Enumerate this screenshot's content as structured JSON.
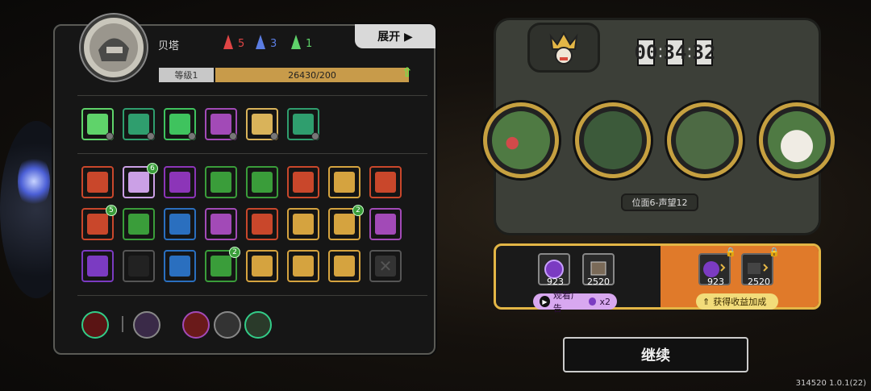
{
  "hero": {
    "name": "贝塔",
    "level_label": "等级1",
    "xp_text": "26430/200",
    "expand_label": "展开 ▶"
  },
  "runes": [
    {
      "color": "#e04545",
      "count": "5"
    },
    {
      "color": "#5b7de2",
      "count": "3"
    },
    {
      "color": "#5fd36a",
      "count": "1"
    }
  ],
  "skills_row1": [
    "#5fd36a",
    "#2f9e6e",
    "#3fc35e",
    "#a24ab7",
    "#d9b35a",
    "#2f9e6e"
  ],
  "skills_grid": [
    [
      "#c9472b",
      "#cba0e6",
      "#8c35b8",
      "#3a9d3a",
      "#3a9d3a",
      "#c9472b",
      "#d5a33f",
      "#c9472b"
    ],
    [
      "#c9472b",
      "#3a9d3a",
      "#2a6fbf",
      "#a24ab7",
      "#c9472b",
      "#d5a33f",
      "#d5a33f",
      "#a24ab7"
    ],
    [
      "#7b3bc2",
      "#222",
      "#2a6fbf",
      "#3a9d3a",
      "#d5a33f",
      "#d5a33f",
      "#d5a33f",
      "#333"
    ]
  ],
  "skill_badges": [
    {
      "row": 0,
      "col": 1,
      "value": "6"
    },
    {
      "row": 1,
      "col": 0,
      "value": "5"
    },
    {
      "row": 1,
      "col": 6,
      "value": "2"
    },
    {
      "row": 2,
      "col": 3,
      "value": "2"
    }
  ],
  "timer": {
    "h": "00",
    "m": "34",
    "s": "32"
  },
  "plane_label": "位面6-声望12",
  "reward": {
    "left_items": [
      {
        "value": "923",
        "icon": "purple-orb-icon"
      },
      {
        "value": "2520",
        "icon": "book-icon"
      }
    ],
    "right_items": [
      {
        "value": "923",
        "icon": "purple-orb-icon"
      },
      {
        "value": "2520",
        "icon": "book-icon"
      }
    ],
    "ad_label": "观看广告",
    "ad_multiplier": "x2",
    "bonus_label": "获得收益加成"
  },
  "continue_label": "继续",
  "version": "314520 1.0.1(22)"
}
